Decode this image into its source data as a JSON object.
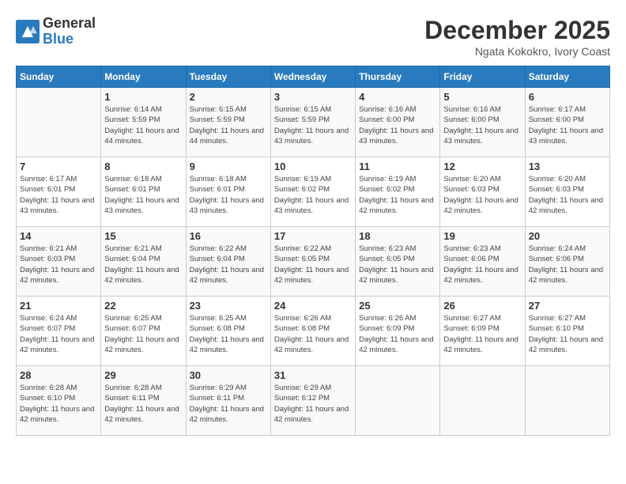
{
  "header": {
    "logo_general": "General",
    "logo_blue": "Blue",
    "month_title": "December 2025",
    "subtitle": "Ngata Kokokro, Ivory Coast"
  },
  "days_of_week": [
    "Sunday",
    "Monday",
    "Tuesday",
    "Wednesday",
    "Thursday",
    "Friday",
    "Saturday"
  ],
  "weeks": [
    [
      {
        "day": "",
        "info": ""
      },
      {
        "day": "1",
        "info": "Sunrise: 6:14 AM\nSunset: 5:59 PM\nDaylight: 11 hours and 44 minutes."
      },
      {
        "day": "2",
        "info": "Sunrise: 6:15 AM\nSunset: 5:59 PM\nDaylight: 11 hours and 44 minutes."
      },
      {
        "day": "3",
        "info": "Sunrise: 6:15 AM\nSunset: 5:59 PM\nDaylight: 11 hours and 43 minutes."
      },
      {
        "day": "4",
        "info": "Sunrise: 6:16 AM\nSunset: 6:00 PM\nDaylight: 11 hours and 43 minutes."
      },
      {
        "day": "5",
        "info": "Sunrise: 6:16 AM\nSunset: 6:00 PM\nDaylight: 11 hours and 43 minutes."
      },
      {
        "day": "6",
        "info": "Sunrise: 6:17 AM\nSunset: 6:00 PM\nDaylight: 11 hours and 43 minutes."
      }
    ],
    [
      {
        "day": "7",
        "info": "Sunrise: 6:17 AM\nSunset: 6:01 PM\nDaylight: 11 hours and 43 minutes."
      },
      {
        "day": "8",
        "info": "Sunrise: 6:18 AM\nSunset: 6:01 PM\nDaylight: 11 hours and 43 minutes."
      },
      {
        "day": "9",
        "info": "Sunrise: 6:18 AM\nSunset: 6:01 PM\nDaylight: 11 hours and 43 minutes."
      },
      {
        "day": "10",
        "info": "Sunrise: 6:19 AM\nSunset: 6:02 PM\nDaylight: 11 hours and 43 minutes."
      },
      {
        "day": "11",
        "info": "Sunrise: 6:19 AM\nSunset: 6:02 PM\nDaylight: 11 hours and 42 minutes."
      },
      {
        "day": "12",
        "info": "Sunrise: 6:20 AM\nSunset: 6:03 PM\nDaylight: 11 hours and 42 minutes."
      },
      {
        "day": "13",
        "info": "Sunrise: 6:20 AM\nSunset: 6:03 PM\nDaylight: 11 hours and 42 minutes."
      }
    ],
    [
      {
        "day": "14",
        "info": "Sunrise: 6:21 AM\nSunset: 6:03 PM\nDaylight: 11 hours and 42 minutes."
      },
      {
        "day": "15",
        "info": "Sunrise: 6:21 AM\nSunset: 6:04 PM\nDaylight: 11 hours and 42 minutes."
      },
      {
        "day": "16",
        "info": "Sunrise: 6:22 AM\nSunset: 6:04 PM\nDaylight: 11 hours and 42 minutes."
      },
      {
        "day": "17",
        "info": "Sunrise: 6:22 AM\nSunset: 6:05 PM\nDaylight: 11 hours and 42 minutes."
      },
      {
        "day": "18",
        "info": "Sunrise: 6:23 AM\nSunset: 6:05 PM\nDaylight: 11 hours and 42 minutes."
      },
      {
        "day": "19",
        "info": "Sunrise: 6:23 AM\nSunset: 6:06 PM\nDaylight: 11 hours and 42 minutes."
      },
      {
        "day": "20",
        "info": "Sunrise: 6:24 AM\nSunset: 6:06 PM\nDaylight: 11 hours and 42 minutes."
      }
    ],
    [
      {
        "day": "21",
        "info": "Sunrise: 6:24 AM\nSunset: 6:07 PM\nDaylight: 11 hours and 42 minutes."
      },
      {
        "day": "22",
        "info": "Sunrise: 6:25 AM\nSunset: 6:07 PM\nDaylight: 11 hours and 42 minutes."
      },
      {
        "day": "23",
        "info": "Sunrise: 6:25 AM\nSunset: 6:08 PM\nDaylight: 11 hours and 42 minutes."
      },
      {
        "day": "24",
        "info": "Sunrise: 6:26 AM\nSunset: 6:08 PM\nDaylight: 11 hours and 42 minutes."
      },
      {
        "day": "25",
        "info": "Sunrise: 6:26 AM\nSunset: 6:09 PM\nDaylight: 11 hours and 42 minutes."
      },
      {
        "day": "26",
        "info": "Sunrise: 6:27 AM\nSunset: 6:09 PM\nDaylight: 11 hours and 42 minutes."
      },
      {
        "day": "27",
        "info": "Sunrise: 6:27 AM\nSunset: 6:10 PM\nDaylight: 11 hours and 42 minutes."
      }
    ],
    [
      {
        "day": "28",
        "info": "Sunrise: 6:28 AM\nSunset: 6:10 PM\nDaylight: 11 hours and 42 minutes."
      },
      {
        "day": "29",
        "info": "Sunrise: 6:28 AM\nSunset: 6:11 PM\nDaylight: 11 hours and 42 minutes."
      },
      {
        "day": "30",
        "info": "Sunrise: 6:29 AM\nSunset: 6:11 PM\nDaylight: 11 hours and 42 minutes."
      },
      {
        "day": "31",
        "info": "Sunrise: 6:29 AM\nSunset: 6:12 PM\nDaylight: 11 hours and 42 minutes."
      },
      {
        "day": "",
        "info": ""
      },
      {
        "day": "",
        "info": ""
      },
      {
        "day": "",
        "info": ""
      }
    ]
  ]
}
